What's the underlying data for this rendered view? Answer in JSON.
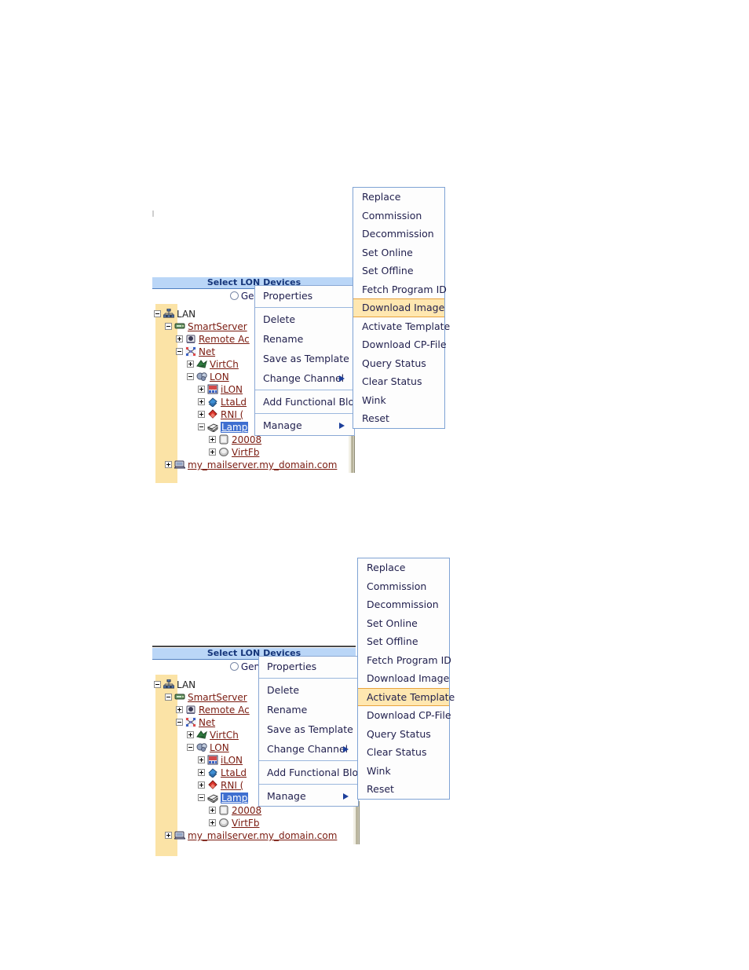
{
  "panels": [
    {
      "id": "upper",
      "header": "Select LON Devices",
      "radio_label": "General",
      "tree": [
        {
          "indent": 0,
          "expander": "minus",
          "icon": "lan-icon",
          "label": "LAN",
          "link": false,
          "selected": false
        },
        {
          "indent": 1,
          "expander": "minus",
          "icon": "smartserver-icon",
          "label": "SmartServer",
          "link": true,
          "selected": false
        },
        {
          "indent": 2,
          "expander": "plus",
          "icon": "remote-access-icon",
          "label": "Remote Ac",
          "link": true,
          "selected": false
        },
        {
          "indent": 2,
          "expander": "minus",
          "icon": "net-icon",
          "label": "Net",
          "link": true,
          "selected": false
        },
        {
          "indent": 3,
          "expander": "plus",
          "icon": "virtch-icon",
          "label": "VirtCh",
          "link": true,
          "selected": false
        },
        {
          "indent": 3,
          "expander": "minus",
          "icon": "lon-icon",
          "label": "LON",
          "link": true,
          "selected": false
        },
        {
          "indent": 4,
          "expander": "plus",
          "icon": "ilon-icon",
          "label": "iLON",
          "link": true,
          "selected": false
        },
        {
          "indent": 4,
          "expander": "plus",
          "icon": "ltald-icon",
          "label": "LtaLd",
          "link": true,
          "selected": false
        },
        {
          "indent": 4,
          "expander": "plus",
          "icon": "rni-icon",
          "label": "RNI (",
          "link": true,
          "selected": false
        },
        {
          "indent": 4,
          "expander": "minus",
          "icon": "lamp-icon",
          "label": "Lamp",
          "link": true,
          "selected": true
        },
        {
          "indent": 5,
          "expander": "plus",
          "icon": "block-icon",
          "label": "20008",
          "link": true,
          "selected": false
        },
        {
          "indent": 5,
          "expander": "plus",
          "icon": "virtfb-icon",
          "label": "VirtFb",
          "link": true,
          "selected": false
        },
        {
          "indent": 1,
          "expander": "plus",
          "icon": "mailserver-icon",
          "label": "my_mailserver.my_domain.com",
          "link": true,
          "selected": false
        }
      ],
      "context_menu": [
        {
          "label": "Properties",
          "sep_after": true,
          "submenu": false
        },
        {
          "label": "Delete",
          "sep_after": false,
          "submenu": false
        },
        {
          "label": "Rename",
          "sep_after": false,
          "submenu": false
        },
        {
          "label": "Save as Template",
          "sep_after": false,
          "submenu": false
        },
        {
          "label": "Change Channel",
          "sep_after": true,
          "submenu": true
        },
        {
          "label": "Add Functional Block",
          "sep_after": true,
          "submenu": false
        },
        {
          "label": "Manage",
          "sep_after": false,
          "submenu": true
        }
      ],
      "submenu": {
        "items": [
          "Replace",
          "Commission",
          "Decommission",
          "Set Online",
          "Set Offline",
          "Fetch Program ID",
          "Download Image",
          "Activate Template",
          "Download CP-File",
          "Query Status",
          "Clear Status",
          "Wink",
          "Reset"
        ],
        "highlighted": "Download Image"
      }
    },
    {
      "id": "lower",
      "header": "Select LON Devices",
      "radio_label": "General",
      "tree": [
        {
          "indent": 0,
          "expander": "minus",
          "icon": "lan-icon",
          "label": "LAN",
          "link": false,
          "selected": false
        },
        {
          "indent": 1,
          "expander": "minus",
          "icon": "smartserver-icon",
          "label": "SmartServer",
          "link": true,
          "selected": false
        },
        {
          "indent": 2,
          "expander": "plus",
          "icon": "remote-access-icon",
          "label": "Remote Ac",
          "link": true,
          "selected": false
        },
        {
          "indent": 2,
          "expander": "minus",
          "icon": "net-icon",
          "label": "Net",
          "link": true,
          "selected": false
        },
        {
          "indent": 3,
          "expander": "plus",
          "icon": "virtch-icon",
          "label": "VirtCh",
          "link": true,
          "selected": false
        },
        {
          "indent": 3,
          "expander": "minus",
          "icon": "lon-icon",
          "label": "LON",
          "link": true,
          "selected": false
        },
        {
          "indent": 4,
          "expander": "plus",
          "icon": "ilon-icon",
          "label": "iLON",
          "link": true,
          "selected": false
        },
        {
          "indent": 4,
          "expander": "plus",
          "icon": "ltald-icon",
          "label": "LtaLd",
          "link": true,
          "selected": false
        },
        {
          "indent": 4,
          "expander": "plus",
          "icon": "rni-icon",
          "label": "RNI (",
          "link": true,
          "selected": false
        },
        {
          "indent": 4,
          "expander": "minus",
          "icon": "lamp-icon",
          "label": "Lamp",
          "link": true,
          "selected": true
        },
        {
          "indent": 5,
          "expander": "plus",
          "icon": "block-icon",
          "label": "20008",
          "link": true,
          "selected": false
        },
        {
          "indent": 5,
          "expander": "plus",
          "icon": "virtfb-icon",
          "label": "VirtFb",
          "link": true,
          "selected": false
        },
        {
          "indent": 1,
          "expander": "plus",
          "icon": "mailserver-icon",
          "label": "my_mailserver.my_domain.com",
          "link": true,
          "selected": false
        }
      ],
      "context_menu": [
        {
          "label": "Properties",
          "sep_after": true,
          "submenu": false
        },
        {
          "label": "Delete",
          "sep_after": false,
          "submenu": false
        },
        {
          "label": "Rename",
          "sep_after": false,
          "submenu": false
        },
        {
          "label": "Save as Template",
          "sep_after": false,
          "submenu": false
        },
        {
          "label": "Change Channel",
          "sep_after": true,
          "submenu": true
        },
        {
          "label": "Add Functional Block",
          "sep_after": true,
          "submenu": false
        },
        {
          "label": "Manage",
          "sep_after": false,
          "submenu": true
        }
      ],
      "submenu": {
        "items": [
          "Replace",
          "Commission",
          "Decommission",
          "Set Online",
          "Set Offline",
          "Fetch Program ID",
          "Download Image",
          "Activate Template",
          "Download CP-File",
          "Query Status",
          "Clear Status",
          "Wink",
          "Reset"
        ],
        "highlighted": "Activate Template"
      }
    }
  ],
  "colors": {
    "header_bg": "#bad6f7",
    "header_text": "#15357a",
    "sidebar_strip": "#fbe3a6",
    "highlight_bg": "#ffe7b0",
    "highlight_border": "#e8a33d",
    "link_text": "#7a1b10",
    "selection_bg": "#3f6fd0",
    "menu_border": "#8aa8d4"
  }
}
